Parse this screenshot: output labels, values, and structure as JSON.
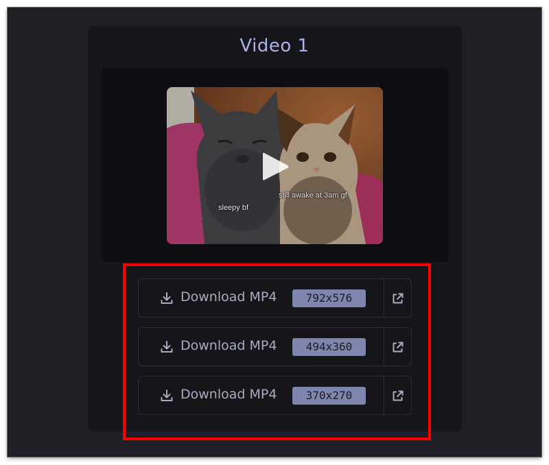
{
  "video": {
    "title": "Video 1",
    "thumbnail_captions": {
      "left": "sleepy bf",
      "right": "still awake at 3am gf"
    },
    "play_icon": "play-icon"
  },
  "downloads": [
    {
      "label": "Download MP4",
      "resolution": "792x576",
      "icon": "download-icon",
      "open_icon": "external-link-icon"
    },
    {
      "label": "Download MP4",
      "resolution": "494x360",
      "icon": "download-icon",
      "open_icon": "external-link-icon"
    },
    {
      "label": "Download MP4",
      "resolution": "370x270",
      "icon": "download-icon",
      "open_icon": "external-link-icon"
    }
  ],
  "colors": {
    "background": "#1f1f25",
    "card": "#15151a",
    "title": "#aab4ea",
    "badge": "#7f86ad",
    "highlight": "#ff0000"
  }
}
